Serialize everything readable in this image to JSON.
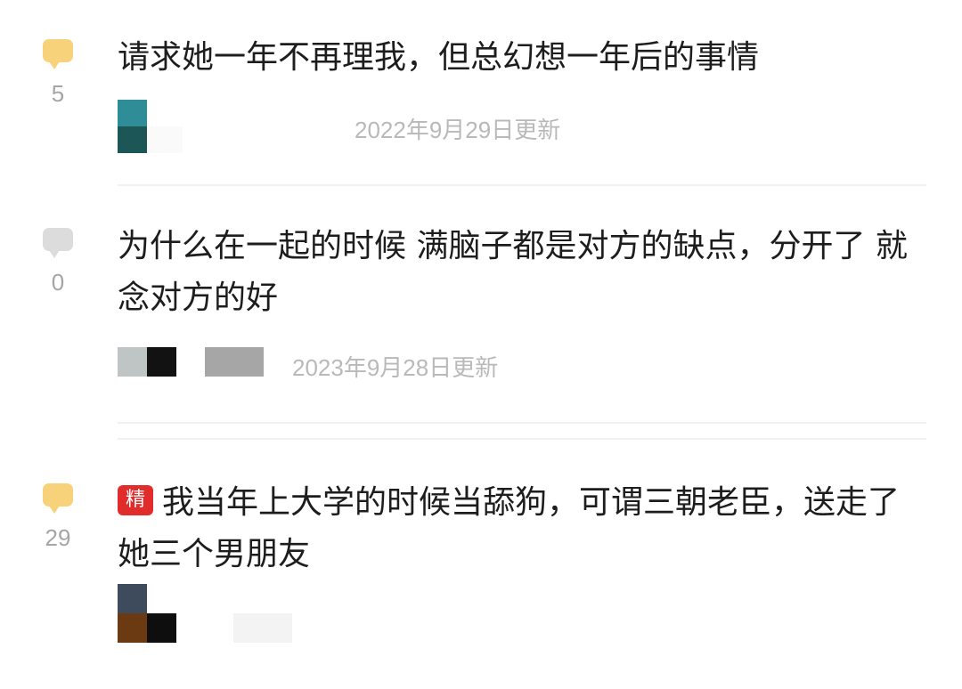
{
  "posts": [
    {
      "count": "5",
      "title": "请求她一年不再理我，但总幻想一年后的事情",
      "date": "2022年9月29日更新"
    },
    {
      "count": "0",
      "title": "为什么在一起的时候 满脑子都是对方的缺点，分开了 就念对方的好",
      "date": "2023年9月28日更新"
    },
    {
      "count": "29",
      "badge": "精",
      "title": "我当年上大学的时候当舔狗，可谓三朝老臣，送走了她三个男朋友"
    }
  ]
}
